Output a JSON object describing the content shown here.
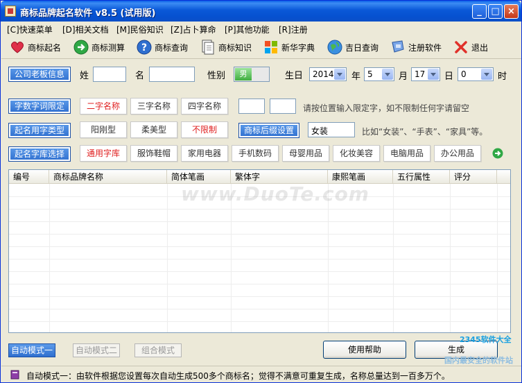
{
  "window": {
    "title": "商标品牌起名软件 v8.5 (试用版)"
  },
  "menu": [
    "[C]快速菜单",
    "[D]相关文档",
    "[M]民俗知识",
    "[Z]占卜算命",
    "[P]其他功能",
    "[R]注册"
  ],
  "toolbar": [
    {
      "label": "商标起名",
      "icon": "heart-icon"
    },
    {
      "label": "商标测算",
      "icon": "arrow-right-icon"
    },
    {
      "label": "商标查询",
      "icon": "help-icon"
    },
    {
      "label": "商标知识",
      "icon": "document-icon"
    },
    {
      "label": "新华字典",
      "icon": "windows-flag-icon"
    },
    {
      "label": "吉日查询",
      "icon": "globe-icon"
    },
    {
      "label": "注册软件",
      "icon": "shield-icon"
    },
    {
      "label": "退出",
      "icon": "close-x-icon"
    }
  ],
  "info_row": {
    "button": "公司老板信息",
    "surname_label": "姓",
    "name_label": "名",
    "gender_label": "性别",
    "gender_value": "男",
    "birth_label": "生日",
    "year": "2014",
    "year_label": "年",
    "month": "5",
    "month_label": "月",
    "day": "17",
    "day_label": "日",
    "hour": "0",
    "hour_label": "时"
  },
  "digits_row": {
    "button": "字数字词限定",
    "options": [
      "二字名称",
      "三字名称",
      "四字名称"
    ],
    "selected": 0,
    "hint": "请按位置输入限定字，如不限制任何字请留空"
  },
  "type_row": {
    "button": "起名用字类型",
    "options": [
      "阳刚型",
      "柔美型",
      "不限制"
    ],
    "selected": 2,
    "suffix_button": "商标后缀设置",
    "suffix_value": "女装",
    "hint": "比如“女装”、“手表”、“家具”等。"
  },
  "library_row": {
    "button": "起名字库选择",
    "options": [
      "通用字库",
      "服饰鞋帽",
      "家用电器",
      "手机数码",
      "母婴用品",
      "化妆美容",
      "电脑用品",
      "办公用品"
    ],
    "selected": 0
  },
  "table": {
    "columns": [
      "编号",
      "商标品牌名称",
      "简体笔画",
      "繁体字",
      "康熙笔画",
      "五行属性",
      "评分"
    ],
    "rows": []
  },
  "watermark": "www.DuoTe.com",
  "modes": [
    "自动模式一",
    "自动模式二",
    "组合模式"
  ],
  "active_mode": 0,
  "help_button": "使用帮助",
  "generate_button": "生成",
  "status": "自动模式一：由软件根据您设置每次自动生成500多个商标名；觉得不满意可重复生成，名称总量达到一百多万个。",
  "corner_logo": {
    "line1": "2345软件大全",
    "line2": "国内最安全的软件站"
  },
  "colors": {
    "accent": "#2F6FCF",
    "selected_text": "#E02020",
    "titlebar": "#0A58D8"
  }
}
